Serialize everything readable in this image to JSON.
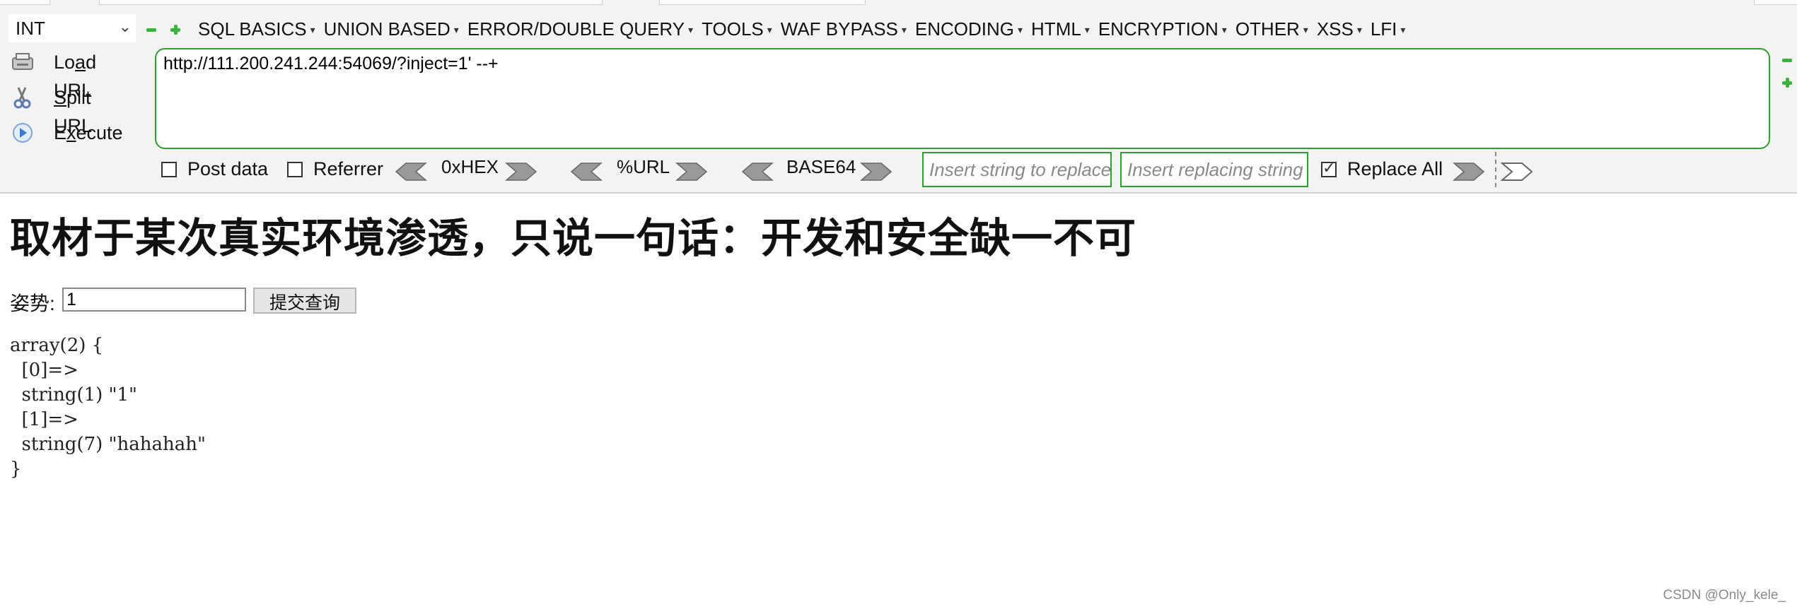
{
  "hackbar": {
    "select_value": "INT",
    "menus": [
      "SQL BASICS",
      "UNION BASED",
      "ERROR/DOUBLE QUERY",
      "TOOLS",
      "WAF BYPASS",
      "ENCODING",
      "HTML",
      "ENCRYPTION",
      "OTHER",
      "XSS",
      "LFI"
    ],
    "actions": {
      "load_pre": "Lo",
      "load_u": "a",
      "load_post": "d URL",
      "split_pre": "",
      "split_u": "S",
      "split_post": "plit URL",
      "exec_pre": "E",
      "exec_u": "x",
      "exec_post": "ecute"
    },
    "url": "http://111.200.241.244:54069/?inject=1' --+",
    "options": {
      "post_data": "Post data",
      "referrer": "Referrer",
      "hex": "0xHEX",
      "url": "%URL",
      "base64": "BASE64",
      "replace_placeholder": "Insert string to replace",
      "replacing_placeholder": "Insert replacing string",
      "replace_all": "Replace All"
    }
  },
  "page": {
    "heading": "取材于某次真实环境渗透，只说一句话：开发和安全缺一不可",
    "form_label": "姿势:",
    "input_value": "1",
    "submit_label": "提交查询",
    "dump": "array(2) {\n  [0]=>\n  string(1) \"1\"\n  [1]=>\n  string(7) \"hahahah\"\n}"
  },
  "watermark": "CSDN @Only_kele_",
  "colors": {
    "accent_green": "#2e9e2e",
    "toolbar_bg": "#f3f3f3"
  }
}
